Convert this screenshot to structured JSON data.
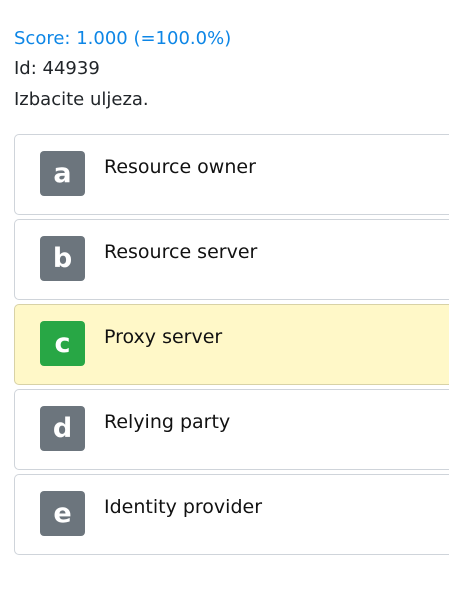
{
  "score": "Score: 1.000 (=100.0%)",
  "id_line": "Id: 44939",
  "prompt": "Izbacite uljeza.",
  "accent_color": "#0d86e6",
  "selected_color": "#28a745",
  "options": [
    {
      "letter": "a",
      "text": "Resource owner",
      "selected": false
    },
    {
      "letter": "b",
      "text": "Resource server",
      "selected": false
    },
    {
      "letter": "c",
      "text": "Proxy server",
      "selected": true
    },
    {
      "letter": "d",
      "text": "Relying party",
      "selected": false
    },
    {
      "letter": "e",
      "text": "Identity provider",
      "selected": false
    }
  ]
}
